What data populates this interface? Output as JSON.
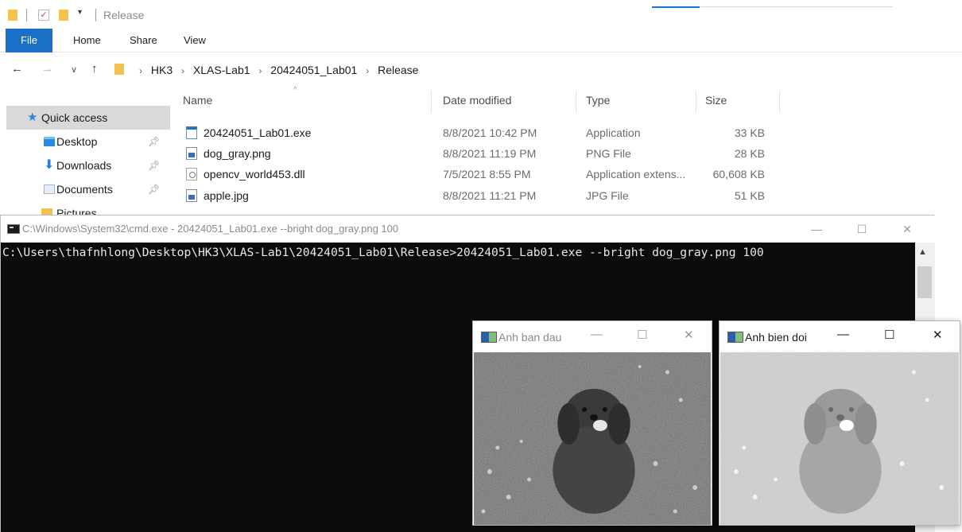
{
  "explorer": {
    "title": "Release",
    "ribbon_tabs": [
      "File",
      "Home",
      "Share",
      "View"
    ],
    "breadcrumbs": [
      "HK3",
      "XLAS-Lab1",
      "20424051_Lab01",
      "Release"
    ],
    "nav_pane": {
      "quick_access": "Quick access",
      "items": [
        "Desktop",
        "Downloads",
        "Documents",
        "Pictures"
      ]
    },
    "columns": [
      "Name",
      "Date modified",
      "Type",
      "Size"
    ],
    "files": [
      {
        "name": "20424051_Lab01.exe",
        "date": "8/8/2021 10:42 PM",
        "type": "Application",
        "size": "33 KB",
        "icon": "exe-file-icon"
      },
      {
        "name": "dog_gray.png",
        "date": "8/8/2021 11:19 PM",
        "type": "PNG File",
        "size": "28 KB",
        "icon": "png-file-icon"
      },
      {
        "name": "opencv_world453.dll",
        "date": "7/5/2021 8:55 PM",
        "type": "Application extens...",
        "size": "60,608 KB",
        "icon": "dll-file-icon"
      },
      {
        "name": "apple.jpg",
        "date": "8/8/2021 11:21 PM",
        "type": "JPG File",
        "size": "51 KB",
        "icon": "jpg-file-icon"
      }
    ]
  },
  "cmd": {
    "title": "C:\\Windows\\System32\\cmd.exe - 20424051_Lab01.exe  --bright dog_gray.png 100",
    "line": "C:\\Users\\thafnhlong\\Desktop\\HK3\\XLAS-Lab1\\20424051_Lab01\\Release>20424051_Lab01.exe --bright dog_gray.png 100",
    "minimize": "—",
    "maximize": "☐",
    "close": "✕"
  },
  "windows": [
    {
      "title": "Anh ban dau",
      "minimize": "—",
      "maximize": "☐",
      "close": "✕",
      "brightness": "original"
    },
    {
      "title": "Anh bien doi",
      "minimize": "—",
      "maximize": "☐",
      "close": "✕",
      "brightness": "bright +100"
    }
  ],
  "colors": {
    "file_tab": "#1a6fc6",
    "quick_access_star": "#2a86e0",
    "folder": "#f2c14e",
    "console_bg": "#0c0c0c",
    "console_text": "#e8e8e8"
  }
}
